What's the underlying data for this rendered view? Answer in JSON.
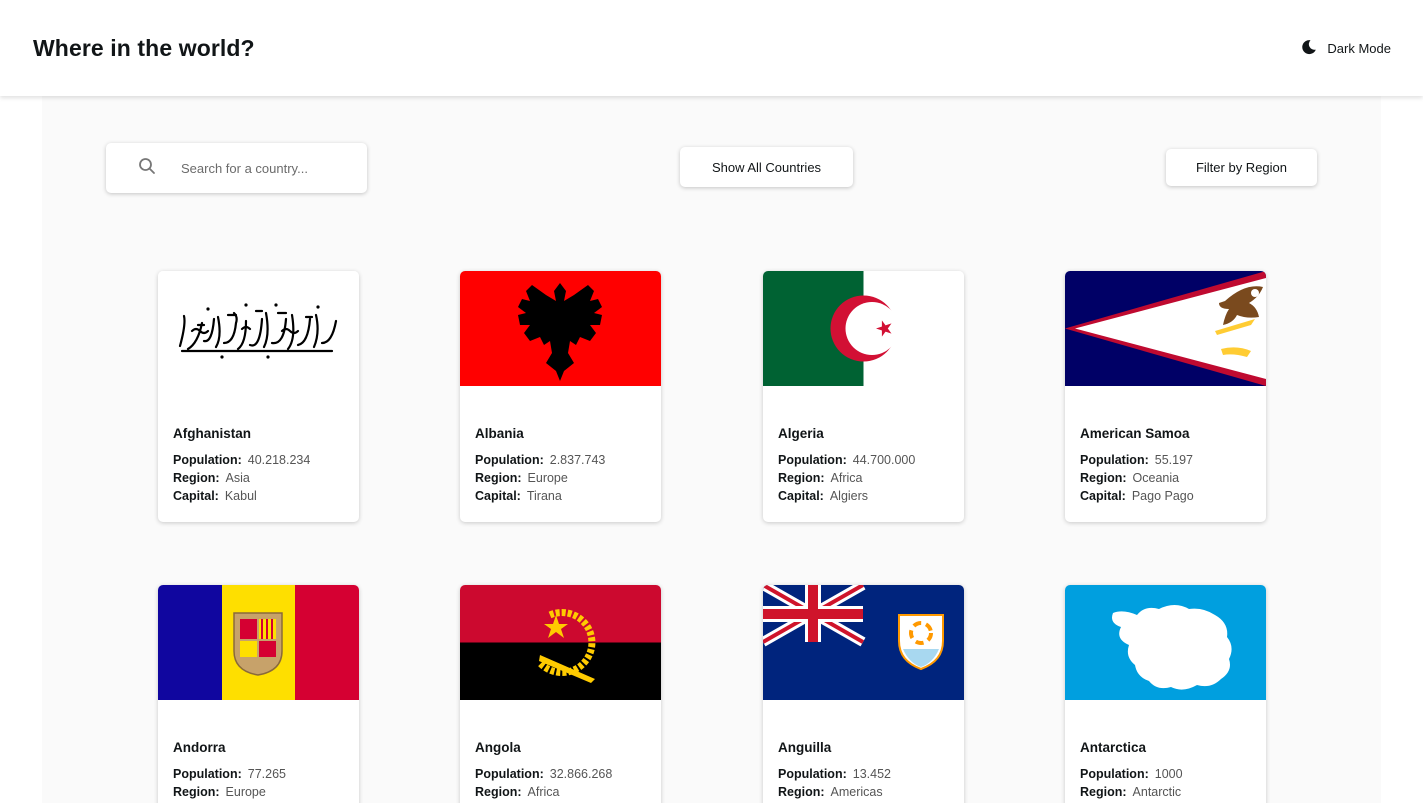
{
  "header": {
    "title": "Where in the world?",
    "mode_label": "Dark Mode"
  },
  "controls": {
    "search_placeholder": "Search for a country...",
    "show_all_label": "Show All Countries",
    "filter_label": "Filter by Region"
  },
  "labels": {
    "population": "Population:",
    "region": "Region:",
    "capital": "Capital:"
  },
  "countries": [
    {
      "name": "Afghanistan",
      "population": "40.218.234",
      "region": "Asia",
      "capital": "Kabul"
    },
    {
      "name": "Albania",
      "population": "2.837.743",
      "region": "Europe",
      "capital": "Tirana"
    },
    {
      "name": "Algeria",
      "population": "44.700.000",
      "region": "Africa",
      "capital": "Algiers"
    },
    {
      "name": "American Samoa",
      "population": "55.197",
      "region": "Oceania",
      "capital": "Pago Pago"
    },
    {
      "name": "Andorra",
      "population": "77.265",
      "region": "Europe",
      "capital": ""
    },
    {
      "name": "Angola",
      "population": "32.866.268",
      "region": "Africa",
      "capital": ""
    },
    {
      "name": "Anguilla",
      "population": "13.452",
      "region": "Americas",
      "capital": ""
    },
    {
      "name": "Antarctica",
      "population": "1000",
      "region": "Antarctic",
      "capital": ""
    }
  ],
  "colors": {
    "background": "#fafafa",
    "element": "#ffffff",
    "text": "#111517",
    "input_text": "#6b6b6b"
  }
}
